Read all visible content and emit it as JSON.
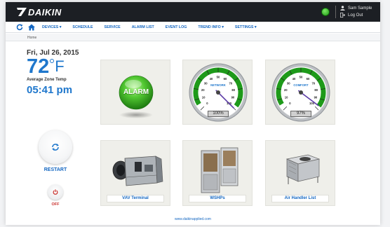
{
  "brand": {
    "name": "DAIKIN"
  },
  "user": {
    "name": "Sam Sample",
    "logout_label": "Log Out"
  },
  "nav": {
    "items": [
      {
        "label": "DEVICES",
        "has_menu": true
      },
      {
        "label": "SCHEDULE",
        "has_menu": false
      },
      {
        "label": "SERVICE",
        "has_menu": false
      },
      {
        "label": "ALARM LIST",
        "has_menu": false
      },
      {
        "label": "EVENT LOG",
        "has_menu": false
      },
      {
        "label": "TREND INFO",
        "has_menu": true
      },
      {
        "label": "SETTINGS",
        "has_menu": true
      }
    ],
    "refresh_icon": "refresh-icon",
    "home_icon": "home-icon"
  },
  "breadcrumb": "Home",
  "status": {
    "date": "Fri, Jul 26, 2015",
    "temp_value": "72",
    "temp_unit": "F",
    "zone_label": "Average Zone Temp",
    "time": "05:41 pm"
  },
  "controls": {
    "restart_label": "RESTART",
    "off_label": "OFF"
  },
  "tiles": {
    "alarm": {
      "label": "ALARM"
    },
    "network": {
      "title": "NETWORK",
      "readout": "100%",
      "value_percent": 100,
      "ticks": [
        "0",
        "10",
        "20",
        "30",
        "40",
        "50",
        "60",
        "70",
        "80",
        "90",
        "100"
      ]
    },
    "comfort": {
      "title": "COMFORT",
      "readout": "97%",
      "value_percent": 97,
      "ticks": [
        "0",
        "10",
        "20",
        "30",
        "40",
        "50",
        "60",
        "70",
        "80",
        "90",
        "100"
      ]
    },
    "vav": {
      "label": "VAV Terminal"
    },
    "wshp": {
      "label": "WSHPs"
    },
    "ahu": {
      "label": "Air Handler List"
    }
  },
  "footer": {
    "link": "www.daikinapplied.com"
  },
  "colors": {
    "accent_blue": "#1f77cc",
    "link_blue": "#1467c2",
    "header_dark": "#1c1f24",
    "alarm_green": "#2fae1e",
    "gauge_green": "#1e9a1a",
    "off_red": "#c9302c"
  }
}
